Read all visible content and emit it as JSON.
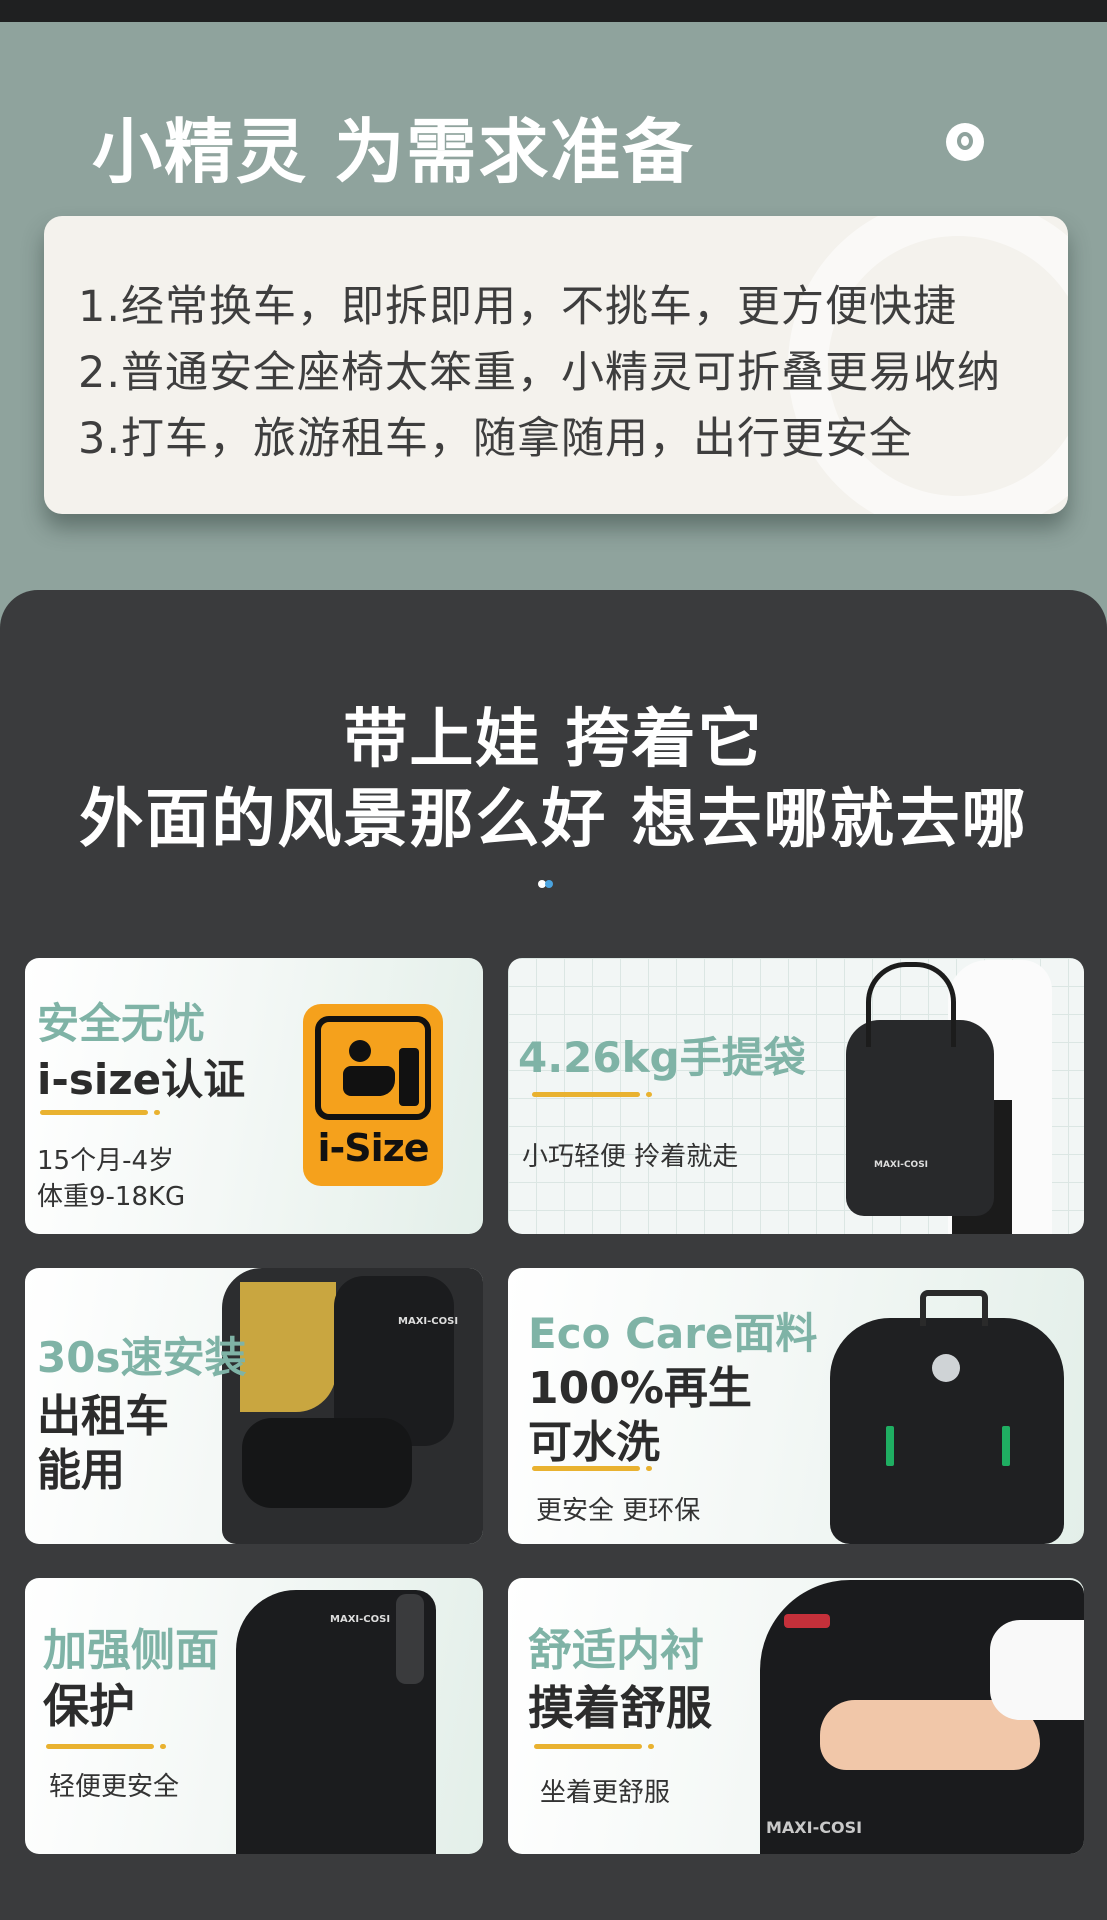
{
  "header": {
    "title": "小精灵 为需求准备",
    "points": [
      "1.经常换车，即拆即用，不挑车，更方便快捷",
      "2.普通安全座椅太笨重，小精灵可折叠更易收纳",
      "3.打车，旅游租车，随拿随用，出行更安全"
    ]
  },
  "slogan": {
    "line1": "带上娃 挎着它",
    "line2": "外面的风景那么好 想去哪就去哪"
  },
  "colors": {
    "sage": "#8fa39d",
    "dark": "#3a3b3d",
    "mint_text": "#7fb3a6",
    "underline": "#e9b230",
    "isize_orange": "#f5a11c"
  },
  "tiles": {
    "isize": {
      "line1": "安全无忧",
      "line2": "i-size认证",
      "sub1": "15个月-4岁",
      "sub2": "体重9-18KG",
      "badge_icon": "isize-badge-icon",
      "badge_text": "i-Size"
    },
    "bag": {
      "title": "4.26kg手提袋",
      "sub": "小巧轻便 拎着就走",
      "bag_brand": "MAXI-COSI"
    },
    "install": {
      "line1": "30s速安装",
      "line2": "出租车",
      "line3": "能用",
      "seat_brand": "MAXI-COSI"
    },
    "eco": {
      "line1": "Eco Care面料",
      "line2": "100%再生",
      "line3": "可水洗",
      "sub": "更安全 更环保"
    },
    "side": {
      "line1": "加强侧面",
      "line2": "保护",
      "sub": "轻便更安全",
      "seat_brand": "MAXI-COSI"
    },
    "comfort": {
      "line1": "舒适内衬",
      "line2": "摸着舒服",
      "sub": "坐着更舒服",
      "seat_brand": "MAXI-COSI"
    }
  }
}
